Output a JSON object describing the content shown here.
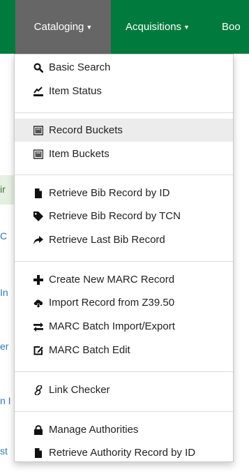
{
  "navbar": {
    "items": [
      {
        "label": "Cataloging"
      },
      {
        "label": "Acquisitions"
      },
      {
        "label": "Boo"
      }
    ]
  },
  "background_fragments": [
    "ir",
    "C",
    "In",
    "er",
    "n I",
    "st"
  ],
  "menu": {
    "items": [
      {
        "label": "Basic Search",
        "icon": "search-icon"
      },
      {
        "label": "Item Status",
        "icon": "item-status-icon"
      },
      {
        "label": "Record Buckets",
        "icon": "bucket-icon"
      },
      {
        "label": "Item Buckets",
        "icon": "bucket-icon"
      },
      {
        "label": "Retrieve Bib Record by ID",
        "icon": "file-icon"
      },
      {
        "label": "Retrieve Bib Record by TCN",
        "icon": "tag-icon"
      },
      {
        "label": "Retrieve Last Bib Record",
        "icon": "share-arrow-icon"
      },
      {
        "label": "Create New MARC Record",
        "icon": "plus-icon"
      },
      {
        "label": "Import Record from Z39.50",
        "icon": "cloud-download-icon"
      },
      {
        "label": "MARC Batch Import/Export",
        "icon": "transfer-icon"
      },
      {
        "label": "MARC Batch Edit",
        "icon": "edit-icon"
      },
      {
        "label": "Link Checker",
        "icon": "link-icon"
      },
      {
        "label": "Manage Authorities",
        "icon": "lock-icon"
      },
      {
        "label": "Retrieve Authority Record by ID",
        "icon": "file-icon"
      }
    ]
  },
  "colors": {
    "navbar": "#007a3d",
    "active_tab": "#666666",
    "hover_row": "#ececec"
  }
}
